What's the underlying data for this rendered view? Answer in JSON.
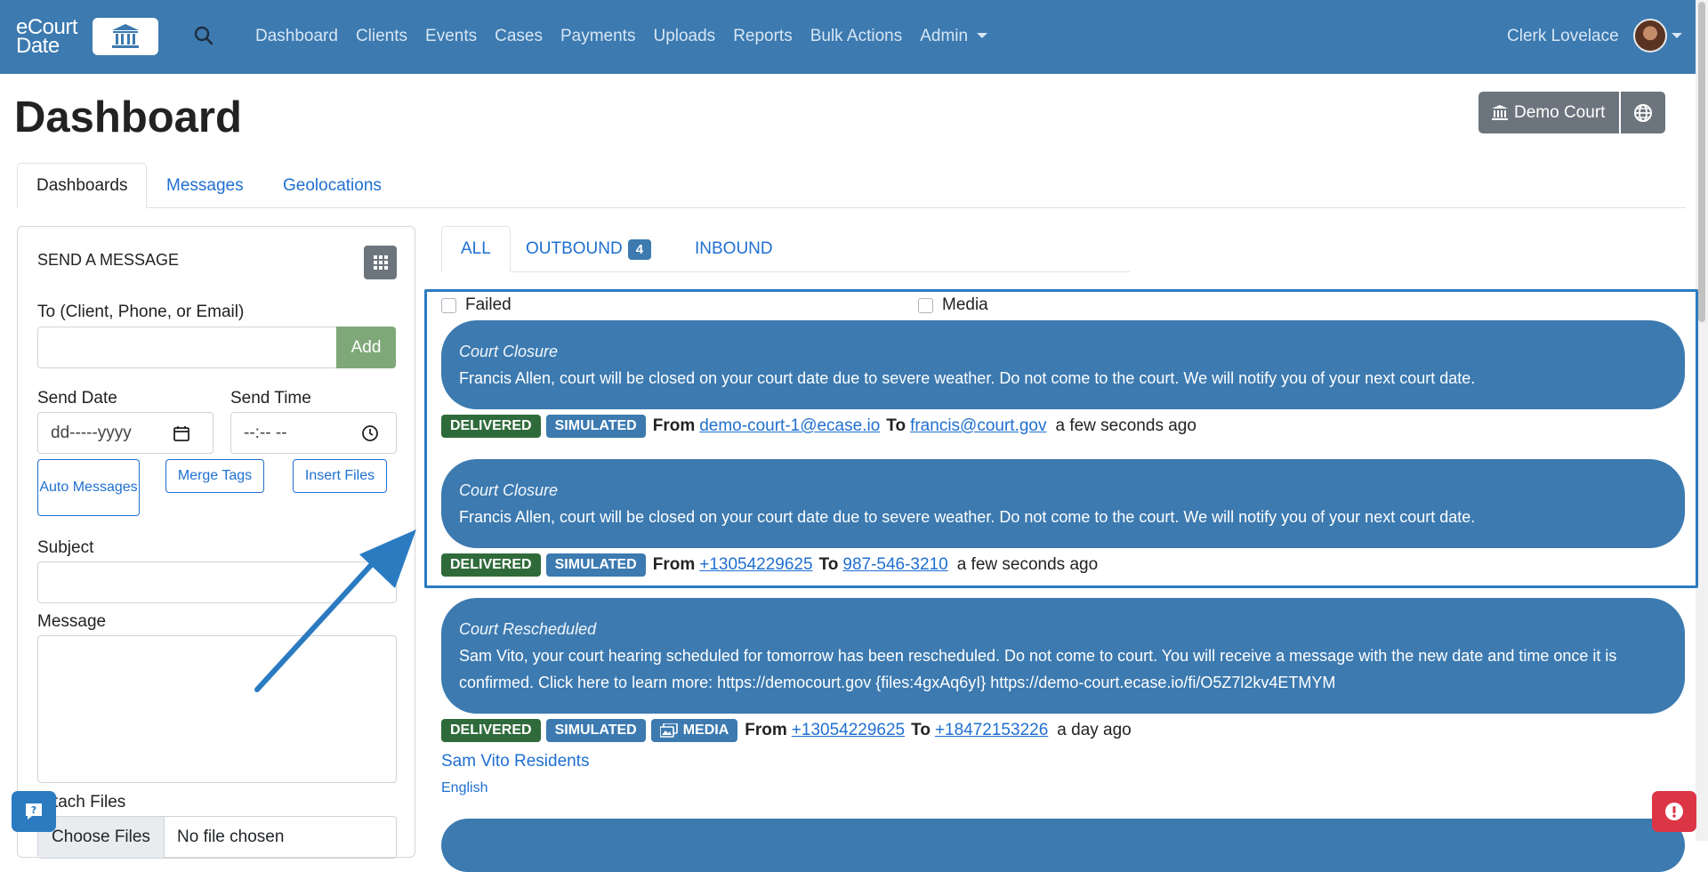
{
  "brand": {
    "line1": "eCourt",
    "line2": "Date"
  },
  "nav": {
    "items": [
      "Dashboard",
      "Clients",
      "Events",
      "Cases",
      "Payments",
      "Uploads",
      "Reports",
      "Bulk Actions",
      "Admin"
    ],
    "user": "Clerk Lovelace"
  },
  "page": {
    "title": "Dashboard",
    "court_button": "Demo Court"
  },
  "tabs": [
    "Dashboards",
    "Messages",
    "Geolocations"
  ],
  "send_message": {
    "title": "SEND A MESSAGE",
    "to_label": "To (Client, Phone, or Email)",
    "add_label": "Add",
    "send_date_label": "Send Date",
    "send_date_placeholder": "dd-----yyyy",
    "send_time_label": "Send Time",
    "send_time_placeholder": "--:-- --",
    "auto_messages": "Auto Messages",
    "merge_tags": "Merge Tags",
    "insert_files": "Insert Files",
    "subject_label": "Subject",
    "message_label": "Message",
    "attach_label": "Attach Files",
    "choose_files": "Choose Files",
    "no_file": "No file chosen"
  },
  "feed": {
    "tabs": [
      "ALL",
      "OUTBOUND",
      "INBOUND"
    ],
    "outbound_count": "4",
    "filters": {
      "failed": "Failed",
      "media": "Media"
    },
    "from_label": "From",
    "to_label": "To",
    "messages": [
      {
        "subject": "Court Closure",
        "body": "Francis Allen, court will be closed on your court date due to severe weather. Do not come to the court. We will notify you of your next court date.",
        "status": "DELIVERED",
        "mode": "SIMULATED",
        "from": "demo-court-1@ecase.io",
        "to": "francis@court.gov",
        "time": "a few seconds ago"
      },
      {
        "subject": "Court Closure",
        "body": "Francis Allen, court will be closed on your court date due to severe weather. Do not come to the court. We will notify you of your next court date.",
        "status": "DELIVERED",
        "mode": "SIMULATED",
        "from": "+13054229625",
        "to": "987-546-3210",
        "time": "a few seconds ago"
      },
      {
        "subject": "Court Rescheduled",
        "body": "Sam Vito, your court hearing scheduled for tomorrow has been rescheduled. Do not come to court. You will receive a message with the new date and time once it is confirmed. Click here to learn more: https://democourt.gov {files:4gxAq6yI} https://demo-court.ecase.io/fi/O5Z7l2kv4ETMYM",
        "status": "DELIVERED",
        "mode": "SIMULATED",
        "media": "MEDIA",
        "from": "+13054229625",
        "to": "+18472153226",
        "time": "a day ago",
        "group_link": "Sam Vito Residents",
        "language": "English"
      }
    ]
  },
  "colors": {
    "navbar": "#3c7ab0",
    "delivered": "#2f6b3a",
    "simulated": "#3c7ab0",
    "link": "#1f6fd1",
    "alert": "#dc3545"
  }
}
